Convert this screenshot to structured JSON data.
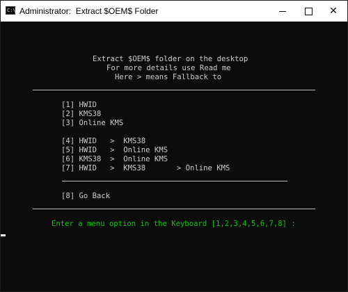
{
  "window": {
    "title": "Administrator:  Extract $OEM$ Folder",
    "icon": "console-icon",
    "controls": [
      "minimize-icon",
      "maximize-icon",
      "close-icon"
    ]
  },
  "console": {
    "header": [
      "Extract $OEM$ folder on the desktop",
      "For more details use Read me",
      "Here > means Fallback to"
    ],
    "options": {
      "o1": "[1] HWID",
      "o2": "[2] KMS38",
      "o3": "[3] Online KMS",
      "o4": "[4] HWID   >  KMS38",
      "o5": "[5] HWID   >  Online KMS",
      "o6": "[6] KMS38  >  Online KMS",
      "o7": "[7] HWID   >  KMS38       > Online KMS",
      "o8": "[8] Go Back"
    },
    "prompt": "Enter a menu option in the Keyboard [1,2,3,4,5,6,7,8] :"
  },
  "colors": {
    "console_bg": "#0c0c0c",
    "text": "#cccccc",
    "prompt": "#13c313"
  }
}
